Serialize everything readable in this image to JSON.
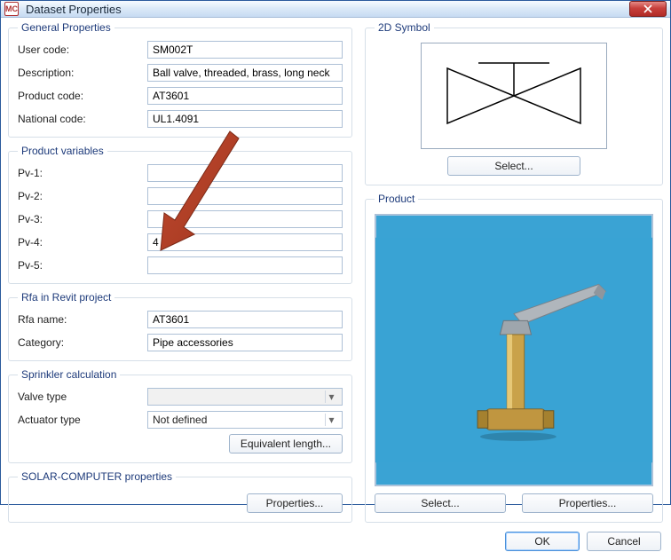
{
  "window": {
    "title": "Dataset Properties",
    "icon": "MC"
  },
  "general": {
    "legend": "General Properties",
    "user_code_label": "User code:",
    "user_code": "SM002T",
    "description_label": "Description:",
    "description": "Ball valve, threaded, brass, long neck",
    "product_code_label": "Product code:",
    "product_code": "AT3601",
    "national_code_label": "National code:",
    "national_code": "UL1.4091"
  },
  "pv": {
    "legend": "Product variables",
    "pv1_label": "Pv-1:",
    "pv1": "",
    "pv2_label": "Pv-2:",
    "pv2": "",
    "pv3_label": "Pv-3:",
    "pv3": "",
    "pv4_label": "Pv-4:",
    "pv4": "4",
    "pv5_label": "Pv-5:",
    "pv5": ""
  },
  "rfa": {
    "legend": "Rfa in Revit project",
    "name_label": "Rfa name:",
    "name": "AT3601",
    "category_label": "Category:",
    "category": "Pipe accessories"
  },
  "sprinkler": {
    "legend": "Sprinkler calculation",
    "valve_label": "Valve type",
    "valve": "",
    "actuator_label": "Actuator type",
    "actuator": "Not defined",
    "equiv_btn": "Equivalent length..."
  },
  "solar": {
    "legend": "SOLAR-COMPUTER properties",
    "properties_btn": "Properties..."
  },
  "right": {
    "symbol_legend": "2D Symbol",
    "symbol_select_btn": "Select...",
    "product_legend": "Product",
    "product_select_btn": "Select...",
    "product_properties_btn": "Properties..."
  },
  "footer": {
    "ok": "OK",
    "cancel": "Cancel"
  }
}
